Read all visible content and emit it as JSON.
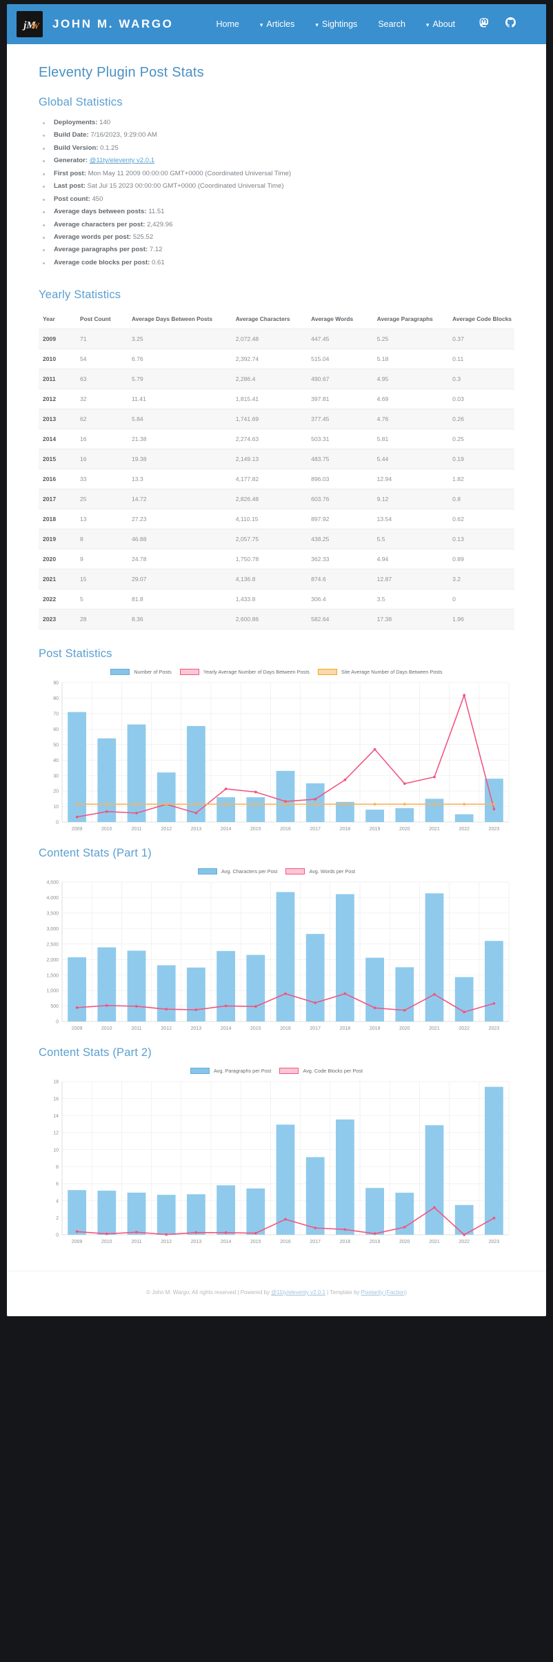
{
  "nav": {
    "brand": "JOHN M. WARGO",
    "logo_icon": "jmw-monogram-logo",
    "links": [
      {
        "label": "Home",
        "caret": false
      },
      {
        "label": "Articles",
        "caret": true
      },
      {
        "label": "Sightings",
        "caret": true
      },
      {
        "label": "Search",
        "caret": false
      },
      {
        "label": "About",
        "caret": true
      }
    ],
    "icons": [
      {
        "name": "mastodon-icon"
      },
      {
        "name": "github-icon"
      }
    ],
    "bg_color": "#3a8fce"
  },
  "page": {
    "title": "Eleventy Plugin Post Stats",
    "global_heading": "Global Statistics",
    "yearly_heading": "Yearly Statistics"
  },
  "global_stats": [
    {
      "label": "Deployments:",
      "value": "140"
    },
    {
      "label": "Build Date:",
      "value": "7/16/2023, 9:29:00 AM"
    },
    {
      "label": "Build Version:",
      "value": "0.1.25"
    },
    {
      "label": "Generator:",
      "value": "@11ty/eleventy v2.0.1",
      "link": true
    },
    {
      "label": "First post:",
      "value": "Mon May 11 2009 00:00:00 GMT+0000 (Coordinated Universal Time)"
    },
    {
      "label": "Last post:",
      "value": "Sat Jul 15 2023 00:00:00 GMT+0000 (Coordinated Universal Time)"
    },
    {
      "label": "Post count:",
      "value": "450"
    },
    {
      "label": "Average days between posts:",
      "value": "11.51"
    },
    {
      "label": "Average characters per post:",
      "value": "2,429.96"
    },
    {
      "label": "Average words per post:",
      "value": "525.52"
    },
    {
      "label": "Average paragraphs per post:",
      "value": "7.12"
    },
    {
      "label": "Average code blocks per post:",
      "value": "0.61"
    }
  ],
  "table": {
    "columns": [
      "Year",
      "Post Count",
      "Average Days Between Posts",
      "Average Characters",
      "Average Words",
      "Average Paragraphs",
      "Average Code Blocks"
    ],
    "rows": [
      [
        "2009",
        "71",
        "3.25",
        "2,072.48",
        "447.45",
        "5.25",
        "0.37"
      ],
      [
        "2010",
        "54",
        "6.76",
        "2,392.74",
        "515.04",
        "5.18",
        "0.11"
      ],
      [
        "2011",
        "63",
        "5.79",
        "2,286.4",
        "490.67",
        "4.95",
        "0.3"
      ],
      [
        "2012",
        "32",
        "11.41",
        "1,815.41",
        "397.81",
        "4.69",
        "0.03"
      ],
      [
        "2013",
        "62",
        "5.84",
        "1,741.69",
        "377.45",
        "4.76",
        "0.26"
      ],
      [
        "2014",
        "16",
        "21.38",
        "2,274.63",
        "503.31",
        "5.81",
        "0.25"
      ],
      [
        "2015",
        "16",
        "19.38",
        "2,149.13",
        "483.75",
        "5.44",
        "0.19"
      ],
      [
        "2016",
        "33",
        "13.3",
        "4,177.82",
        "896.03",
        "12.94",
        "1.82"
      ],
      [
        "2017",
        "25",
        "14.72",
        "2,826.48",
        "603.76",
        "9.12",
        "0.8"
      ],
      [
        "2018",
        "13",
        "27.23",
        "4,110.15",
        "897.92",
        "13.54",
        "0.62"
      ],
      [
        "2019",
        "8",
        "46.88",
        "2,057.75",
        "438.25",
        "5.5",
        "0.13"
      ],
      [
        "2020",
        "9",
        "24.78",
        "1,750.78",
        "362.33",
        "4.94",
        "0.89"
      ],
      [
        "2021",
        "15",
        "29.07",
        "4,136.8",
        "874.6",
        "12.87",
        "3.2"
      ],
      [
        "2022",
        "5",
        "81.8",
        "1,433.8",
        "306.4",
        "3.5",
        "0"
      ],
      [
        "2023",
        "28",
        "8.36",
        "2,600.86",
        "582.64",
        "17.38",
        "1.96"
      ]
    ]
  },
  "charts": {
    "post_stats_title": "Post Statistics",
    "content_part1_title": "Content Stats (Part 1)",
    "content_part2_title": "Content Stats (Part 2)"
  },
  "colors": {
    "bar_blue": "#85c5ea",
    "line_pink": "#f2557f",
    "line_orange": "#f7b35c",
    "accent": "#5a9fd0",
    "nav": "#3a8fce"
  },
  "chart_data": [
    {
      "type": "bar",
      "title": "Post Statistics",
      "categories": [
        "2009",
        "2010",
        "2011",
        "2012",
        "2013",
        "2014",
        "2015",
        "2016",
        "2017",
        "2018",
        "2019",
        "2020",
        "2021",
        "2022",
        "2023"
      ],
      "series": [
        {
          "name": "Number of Posts",
          "kind": "bar",
          "color": "#85c5ea",
          "values": [
            71,
            54,
            63,
            32,
            62,
            16,
            16,
            33,
            25,
            13,
            8,
            9,
            15,
            5,
            28
          ]
        },
        {
          "name": "Yearly Average Number of Days Between Posts",
          "kind": "line",
          "color": "#f2557f",
          "values": [
            3.25,
            6.76,
            5.79,
            11.41,
            5.84,
            21.38,
            19.38,
            13.3,
            14.72,
            27.23,
            46.88,
            24.78,
            29.07,
            81.8,
            8.36
          ]
        },
        {
          "name": "Site Average Number of Days Between Posts",
          "kind": "line",
          "color": "#f7b35c",
          "values": [
            11.51,
            11.51,
            11.51,
            11.51,
            11.51,
            11.51,
            11.51,
            11.51,
            11.51,
            11.51,
            11.51,
            11.51,
            11.51,
            11.51,
            11.51
          ]
        }
      ],
      "ylim": [
        0,
        90
      ],
      "yticks": [
        0,
        10,
        20,
        30,
        40,
        50,
        60,
        70,
        80,
        90
      ],
      "xlabel": "",
      "ylabel": "",
      "grid": true,
      "legend_position": "top"
    },
    {
      "type": "bar",
      "title": "Content Stats (Part 1)",
      "categories": [
        "2009",
        "2010",
        "2011",
        "2012",
        "2013",
        "2014",
        "2015",
        "2016",
        "2017",
        "2018",
        "2019",
        "2020",
        "2021",
        "2022",
        "2023"
      ],
      "series": [
        {
          "name": "Avg. Characters per Post",
          "kind": "bar",
          "color": "#85c5ea",
          "values": [
            2072.48,
            2392.74,
            2286.4,
            1815.41,
            1741.69,
            2274.63,
            2149.13,
            4177.82,
            2826.48,
            4110.15,
            2057.75,
            1750.78,
            4136.8,
            1433.8,
            2600.86
          ]
        },
        {
          "name": "Avg. Words per Post",
          "kind": "line",
          "color": "#f2557f",
          "values": [
            447.45,
            515.04,
            490.67,
            397.81,
            377.45,
            503.31,
            483.75,
            896.03,
            603.76,
            897.92,
            438.25,
            362.33,
            874.6,
            306.4,
            582.64
          ]
        }
      ],
      "ylim": [
        0,
        4500
      ],
      "yticks": [
        0,
        500,
        1000,
        1500,
        2000,
        2500,
        3000,
        3500,
        4000,
        4500
      ],
      "ytick_labels": [
        "0",
        "500",
        "1,000",
        "1,500",
        "2,000",
        "2,500",
        "3,000",
        "3,500",
        "4,000",
        "4,500"
      ],
      "xlabel": "",
      "ylabel": "",
      "grid": true,
      "legend_position": "top"
    },
    {
      "type": "bar",
      "title": "Content Stats (Part 2)",
      "categories": [
        "2009",
        "2010",
        "2011",
        "2012",
        "2013",
        "2014",
        "2015",
        "2016",
        "2017",
        "2018",
        "2019",
        "2020",
        "2021",
        "2022",
        "2023"
      ],
      "series": [
        {
          "name": "Avg. Paragraphs per Post",
          "kind": "bar",
          "color": "#85c5ea",
          "values": [
            5.25,
            5.18,
            4.95,
            4.69,
            4.76,
            5.81,
            5.44,
            12.94,
            9.12,
            13.54,
            5.5,
            4.94,
            12.87,
            3.5,
            17.38
          ]
        },
        {
          "name": "Avg. Code Blocks per Post",
          "kind": "line",
          "color": "#f2557f",
          "values": [
            0.37,
            0.11,
            0.3,
            0.03,
            0.26,
            0.25,
            0.19,
            1.82,
            0.8,
            0.62,
            0.13,
            0.89,
            3.2,
            0,
            1.96
          ]
        }
      ],
      "ylim": [
        0,
        18
      ],
      "yticks": [
        0,
        2,
        4,
        6,
        8,
        10,
        12,
        14,
        16,
        18
      ],
      "xlabel": "",
      "ylabel": "",
      "grid": true,
      "legend_position": "top"
    }
  ],
  "footer": {
    "copyright": "© John M. Wargo; All rights reserved | Powered by ",
    "powered_link": "@11ty/eleventy v2.0.1",
    "middle": " | Template by ",
    "template_link": "Pixelarity (Faction)"
  }
}
